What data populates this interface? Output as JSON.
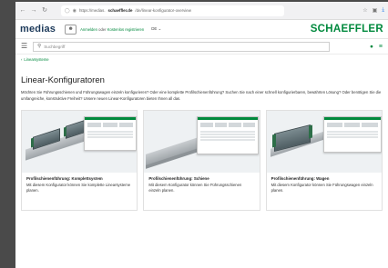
{
  "browser": {
    "back_icon": "arrow-left-icon",
    "url_prefix": "https://medias.",
    "url_domain": "schaeffler.de",
    "url_path": "/de/linear-konfigurator-overview"
  },
  "header": {
    "logo": "medias",
    "login": "Anmelden",
    "login_sep": "oder",
    "register": "Kostenlos registrieren",
    "lang": "DE"
  },
  "brand": {
    "logo": "SCHAEFFLER"
  },
  "search": {
    "placeholder": "Suchbegriff"
  },
  "breadcrumb": {
    "back": "Linearsysteme"
  },
  "page": {
    "title": "Linear-Konfiguratoren",
    "intro": "Möchten Sie Führungsschienen und Führungswagen einzeln konfigurieren? Oder eine komplette Profilschienenführung? Suchen Sie nach einer schnell konfigurierbaren, bewährten Lösung? Oder benötigen Sie die umfangreiche, konstruktive Freiheit? Unsere neuen Linear-Konfiguratoren bieten Ihnen all das."
  },
  "cards": [
    {
      "title": "Profilschienenführung: Komplettsystem",
      "text": "Mit diesem Konfigurator können Sie komplette Linearsysteme planen."
    },
    {
      "title": "Profilschienenführung: Schiene",
      "text": "Mit diesem Konfigurator können Sie Führungsschienen einzeln planen."
    },
    {
      "title": "Profilschienenführung: Wagen",
      "text": "Mit diesem Konfigurator können Sie Führungswagen einzeln planen."
    }
  ],
  "colors": {
    "brand_green": "#00893d",
    "medias_blue": "#1d3a5a"
  }
}
